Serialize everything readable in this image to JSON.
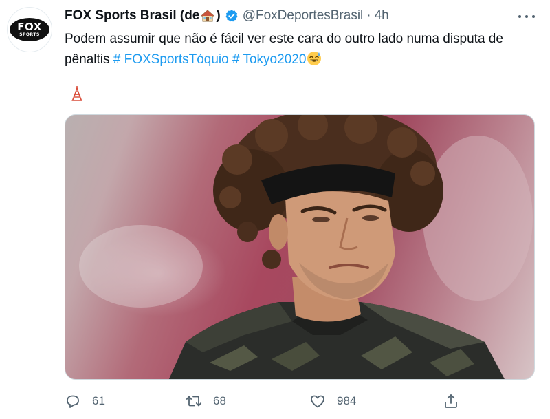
{
  "account": {
    "display_name": "FOX Sports Brasil (de",
    "display_name_close": ")",
    "handle": "@FoxDeportesBrasil",
    "separator": "·",
    "time": "4h",
    "avatar_text_main": "FOX",
    "avatar_text_sub": "SPORTS"
  },
  "tweet": {
    "text": "Podem assumir que não é fácil ver este cara do outro lado numa disputa de pênaltis",
    "hashtags": [
      "# FOXSportsTóquio",
      "# Tokyo2020"
    ]
  },
  "actions": {
    "reply_count": "61",
    "retweet_count": "68",
    "like_count": "984"
  },
  "colors": {
    "accent": "#1d9bf0",
    "secondary_text": "#536471",
    "verified": "#1d9bf0"
  },
  "icons": [
    "house-emoji-icon",
    "verified-badge-icon",
    "more-options-icon",
    "sweat-smile-emoji-icon",
    "tokyo-tower-emoji-icon",
    "reply-icon",
    "retweet-icon",
    "like-icon",
    "share-icon"
  ]
}
